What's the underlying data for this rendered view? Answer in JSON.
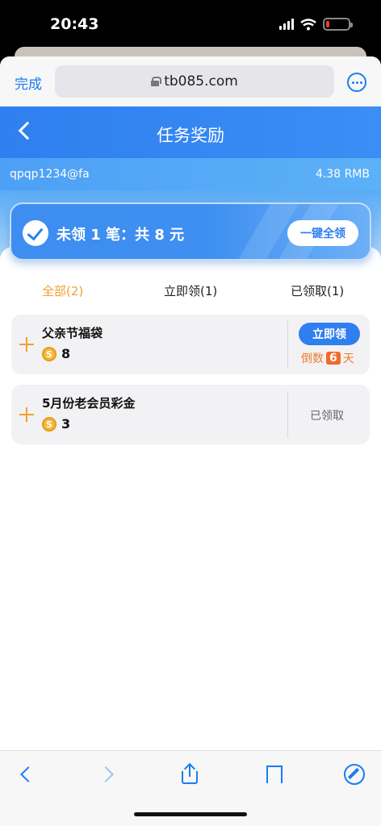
{
  "status_bar": {
    "time": "20:43",
    "battery_level": 0.15
  },
  "browser": {
    "done_label": "完成",
    "url": "tb085.com"
  },
  "header": {
    "title": "任务奖励"
  },
  "account": {
    "username": "qpqp1234@fa",
    "balance": "4.38 RMB"
  },
  "summary": {
    "text": "未领 1 笔：共 8 元",
    "claim_all_label": "一键全领"
  },
  "tabs": [
    {
      "label": "全部(2)",
      "active": true
    },
    {
      "label": "立即领(1)",
      "active": false
    },
    {
      "label": "已领取(1)",
      "active": false
    }
  ],
  "tasks": [
    {
      "name": "父亲节福袋",
      "coin_symbol": "S",
      "amount": "8",
      "action_label": "立即领",
      "countdown_prefix": "倒数",
      "countdown_days": "6",
      "countdown_suffix": "天"
    },
    {
      "name": "5月份老会员彩金",
      "coin_symbol": "S",
      "amount": "3",
      "status_label": "已领取"
    }
  ],
  "colors": {
    "accent": "#2f7ff0",
    "active_tab": "#f0a030",
    "countdown": "#f26a2a"
  },
  "toolbar_icons": [
    "back-icon",
    "forward-icon",
    "share-icon",
    "bookmark-icon",
    "compass-icon"
  ]
}
